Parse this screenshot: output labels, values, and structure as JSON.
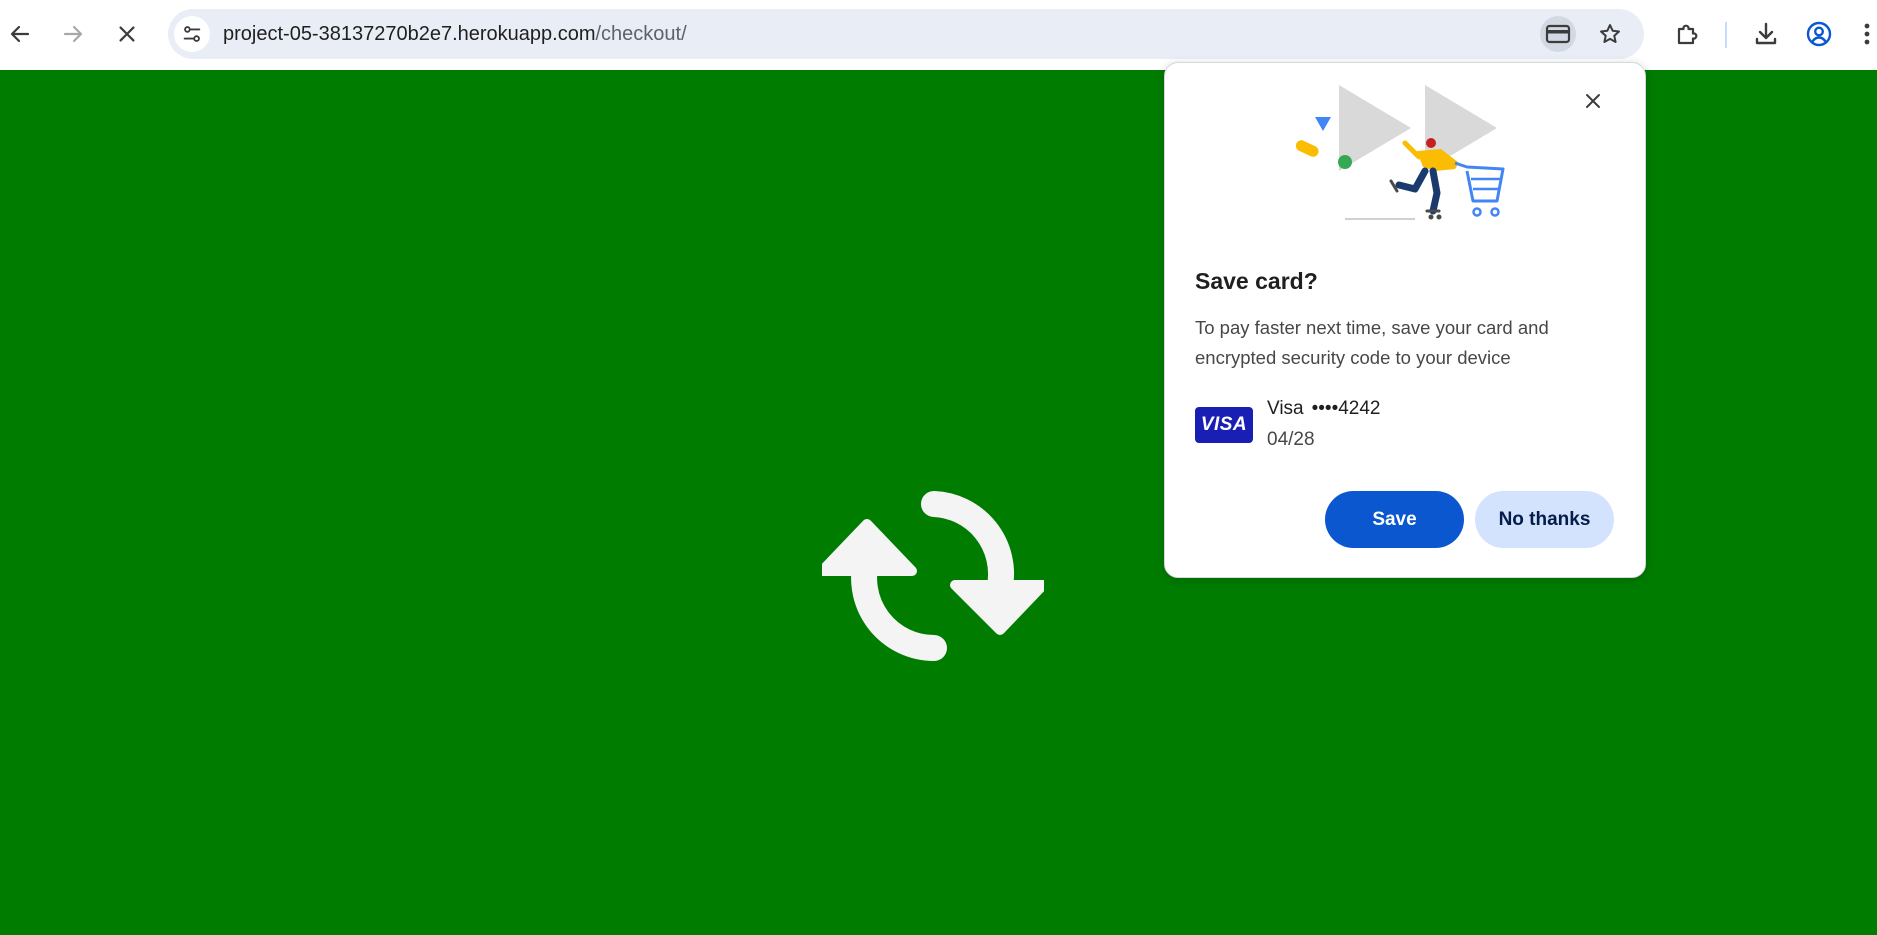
{
  "toolbar": {
    "url_host": "project-05-38137270b2e7.herokuapp.com",
    "url_path": "/checkout/",
    "icons": {
      "back": "arrow-left-icon",
      "forward": "arrow-right-icon",
      "stop": "close-icon",
      "site_info": "tune-icon",
      "payment": "credit-card-icon",
      "bookmark": "star-icon",
      "extensions": "puzzle-icon",
      "downloads": "download-icon",
      "profile": "account-circle-icon",
      "menu": "kebab-menu-icon"
    }
  },
  "page": {
    "background": "#007c00",
    "icon": "refresh-sync-icon"
  },
  "bubble": {
    "title": "Save card?",
    "description": "To pay faster next time, save your card and encrypted security code to your device",
    "card_brand": "VISA",
    "card_network": "Visa",
    "card_digits": "••••4242",
    "card_expiry": "04/28",
    "save_label": "Save",
    "decline_label": "No thanks",
    "colors": {
      "primary": "#0b57d0",
      "secondary": "#d3e3fd",
      "visa": "#1a1fb4"
    }
  }
}
